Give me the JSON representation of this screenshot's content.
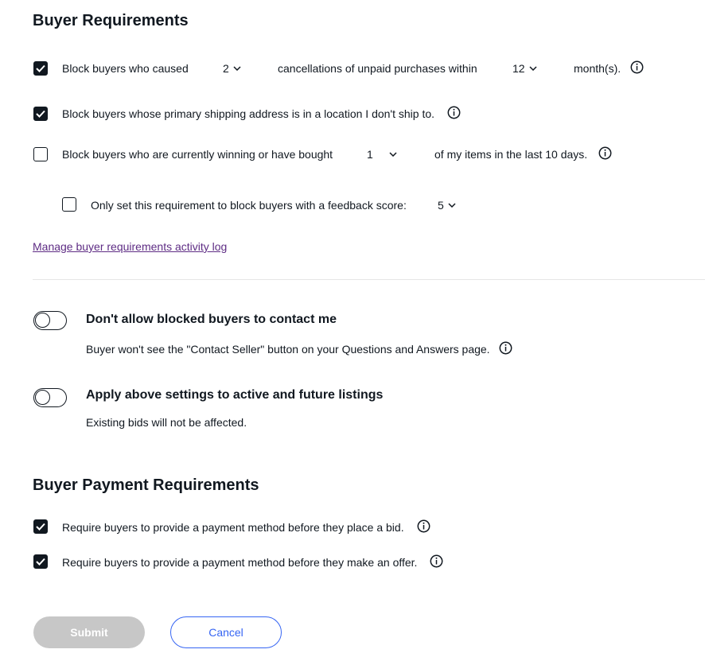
{
  "buyer_requirements": {
    "title": "Buyer Requirements",
    "cancellations_rule": {
      "checked": true,
      "text_before": "Block buyers who caused",
      "count_value": "2",
      "text_middle": "cancellations of unpaid purchases within",
      "months_value": "12",
      "text_after": "month(s)."
    },
    "shipping_rule": {
      "checked": true,
      "text": "Block buyers whose primary shipping address is in a location I don't ship to."
    },
    "winning_rule": {
      "checked": false,
      "text_before": "Block buyers who are currently winning or have bought",
      "items_value": "1",
      "text_after": "of my items in the last 10 days."
    },
    "feedback_rule": {
      "checked": false,
      "text": "Only set this requirement to block buyers with a feedback score:",
      "score_value": "5"
    },
    "activity_log_link": "Manage buyer requirements activity log"
  },
  "toggles": {
    "contact": {
      "on": false,
      "title": "Don't allow blocked buyers to contact me",
      "description": "Buyer won't see the \"Contact Seller\" button on your Questions and Answers page."
    },
    "apply": {
      "on": false,
      "title": "Apply above settings to active and future listings",
      "description": "Existing bids will not be affected."
    }
  },
  "payment_requirements": {
    "title": "Buyer Payment Requirements",
    "bid_rule": {
      "checked": true,
      "text": "Require buyers to provide a payment method before they place a bid."
    },
    "offer_rule": {
      "checked": true,
      "text": "Require buyers to provide a payment method before they make an offer."
    }
  },
  "buttons": {
    "submit": "Submit",
    "cancel": "Cancel"
  },
  "colors": {
    "text": "#111820",
    "link": "#5e2c84",
    "accent_blue": "#3665f3",
    "disabled_button": "#c7c7c7",
    "divider": "#e5e5e5"
  },
  "icons": [
    "checkmark-icon",
    "chevron-down-icon",
    "info-icon"
  ]
}
